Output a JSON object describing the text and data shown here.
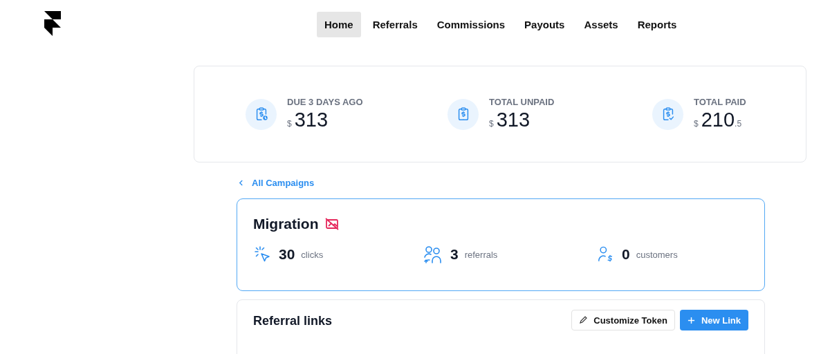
{
  "nav": [
    {
      "label": "Home",
      "selected": true
    },
    {
      "label": "Referrals",
      "selected": false
    },
    {
      "label": "Commissions",
      "selected": false
    },
    {
      "label": "Payouts",
      "selected": false
    },
    {
      "label": "Assets",
      "selected": false
    },
    {
      "label": "Reports",
      "selected": false
    }
  ],
  "summary": [
    {
      "kind": "due",
      "label": "DUE 3 DAYS AGO",
      "currency": "$",
      "amount": "313"
    },
    {
      "kind": "unpaid",
      "label": "TOTAL UNPAID",
      "currency": "$",
      "amount": "313"
    },
    {
      "kind": "paid",
      "label": "TOTAL PAID",
      "currency": "$",
      "amount": "210",
      "fraction": ".5"
    }
  ],
  "back_link": "All Campaigns",
  "campaign": {
    "name": "Migration",
    "metrics": [
      {
        "kind": "clicks",
        "value": "30",
        "label": "clicks"
      },
      {
        "kind": "referrals",
        "value": "3",
        "label": "referrals"
      },
      {
        "kind": "customers",
        "value": "0",
        "label": "customers"
      }
    ]
  },
  "links_panel": {
    "title": "Referral links",
    "buttons": [
      {
        "kind": "secondary",
        "label": "Customize Token"
      },
      {
        "kind": "primary",
        "label": "New Link"
      }
    ]
  }
}
